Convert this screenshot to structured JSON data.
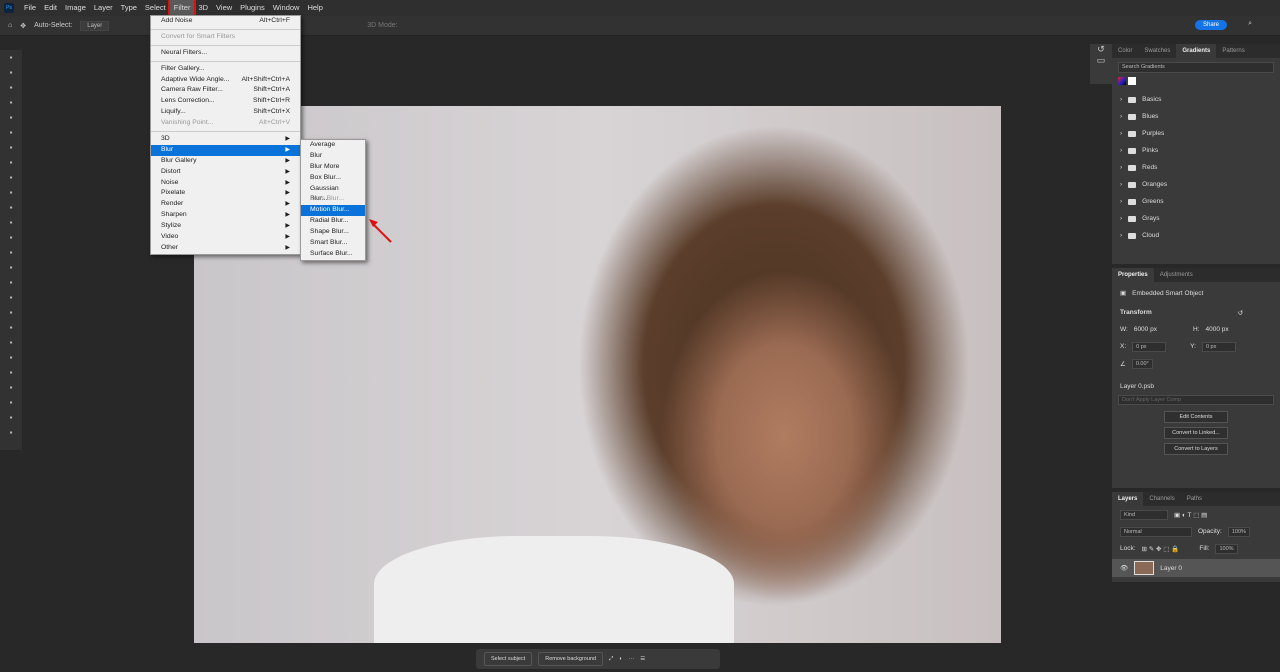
{
  "menubar": {
    "items": [
      "File",
      "Edit",
      "Image",
      "Layer",
      "Type",
      "Select",
      "Filter",
      "3D",
      "View",
      "Plugins",
      "Window",
      "Help"
    ],
    "active": "Filter"
  },
  "options": {
    "auto_select": "Auto-Select:",
    "layer_select": "Layer",
    "mode_label": "3D Mode:",
    "share": "Share"
  },
  "filter_menu": [
    {
      "label": "Add Noise",
      "shortcut": "Alt+Ctrl+F"
    },
    {
      "sep": true
    },
    {
      "label": "Convert for Smart Filters",
      "disabled": true
    },
    {
      "sep": true
    },
    {
      "label": "Neural Filters..."
    },
    {
      "sep": true
    },
    {
      "label": "Filter Gallery..."
    },
    {
      "label": "Adaptive Wide Angle...",
      "shortcut": "Alt+Shift+Ctrl+A"
    },
    {
      "label": "Camera Raw Filter...",
      "shortcut": "Shift+Ctrl+A"
    },
    {
      "label": "Lens Correction...",
      "shortcut": "Shift+Ctrl+R"
    },
    {
      "label": "Liquify...",
      "shortcut": "Shift+Ctrl+X"
    },
    {
      "label": "Vanishing Point...",
      "shortcut": "Alt+Ctrl+V",
      "disabled": true
    },
    {
      "sep": true
    },
    {
      "label": "3D",
      "sub": true
    },
    {
      "label": "Blur",
      "sub": true,
      "highlighted": true
    },
    {
      "label": "Blur Gallery",
      "sub": true
    },
    {
      "label": "Distort",
      "sub": true
    },
    {
      "label": "Noise",
      "sub": true
    },
    {
      "label": "Pixelate",
      "sub": true
    },
    {
      "label": "Render",
      "sub": true
    },
    {
      "label": "Sharpen",
      "sub": true
    },
    {
      "label": "Stylize",
      "sub": true
    },
    {
      "label": "Video",
      "sub": true
    },
    {
      "label": "Other",
      "sub": true
    }
  ],
  "blur_menu": [
    {
      "label": "Average"
    },
    {
      "label": "Blur"
    },
    {
      "label": "Blur More"
    },
    {
      "label": "Box Blur..."
    },
    {
      "label": "Gaussian Blur..."
    },
    {
      "label": "Lens Blur...",
      "disabled": true
    },
    {
      "label": "Motion Blur...",
      "highlighted": true
    },
    {
      "label": "Radial Blur..."
    },
    {
      "label": "Shape Blur..."
    },
    {
      "label": "Smart Blur..."
    },
    {
      "label": "Surface Blur..."
    }
  ],
  "gradients": {
    "tabs": [
      "Color",
      "Swatches",
      "Gradients",
      "Patterns"
    ],
    "active": "Gradients",
    "search_placeholder": "Search Gradients",
    "folders": [
      "Basics",
      "Blues",
      "Purples",
      "Pinks",
      "Reds",
      "Oranges",
      "Greens",
      "Grays",
      "Cloud"
    ]
  },
  "properties": {
    "tabs": [
      "Properties",
      "Adjustments"
    ],
    "type": "Embedded Smart Object",
    "transform": "Transform",
    "w_label": "W:",
    "w": "6000 px",
    "h_label": "H:",
    "h": "4000 px",
    "x_label": "X:",
    "x": "0 px",
    "y_label": "Y:",
    "y": "0 px",
    "angle": "0.00°",
    "file": "Layer 0.psb",
    "comp": "Don't Apply Layer Comp",
    "buttons": [
      "Edit Contents",
      "Convert to Linked...",
      "Convert to Layers"
    ]
  },
  "layers": {
    "tabs": [
      "Layers",
      "Channels",
      "Paths"
    ],
    "kind": "Kind",
    "blend": "Normal",
    "opacity_label": "Opacity:",
    "opacity": "100%",
    "lock_label": "Lock:",
    "fill_label": "Fill:",
    "fill": "100%",
    "layer_name": "Layer 0"
  },
  "bottombar": {
    "select_subject": "Select subject",
    "remove_background": "Remove background",
    "more": "···"
  },
  "colors": {
    "accent": "#0a73d9",
    "highlight_box": "#e01010"
  }
}
